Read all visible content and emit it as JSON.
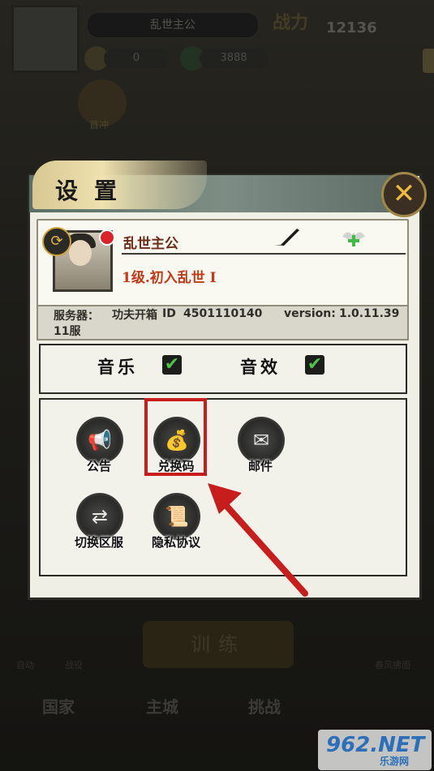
{
  "background": {
    "top_name": "乱世主公",
    "power_label": "战力",
    "power_value": "12136",
    "resource_coin": "0",
    "resource_jade": "3888",
    "gift_label": "首冲",
    "train_label": "训练",
    "bottom_nav": [
      "国家",
      "主城",
      "挑战"
    ],
    "bottom_small": [
      "自动",
      "战役",
      "春风拂面"
    ],
    "watermark": "962.NET",
    "watermark_sub": "乐游网"
  },
  "dialog": {
    "title": "设置",
    "close_icon": "close-x-icon",
    "profile": {
      "name": "乱世主公",
      "level": "1级.初入乱世 I",
      "server_label": "服务器：",
      "server_value": "功夫开箱11服",
      "id_label": "ID",
      "id_value": "4501110140",
      "version_label": "version:",
      "version_value": "1.0.11.39"
    },
    "audio": {
      "music_label": "音乐",
      "music_checked": true,
      "sfx_label": "音效",
      "sfx_checked": true
    },
    "menu": [
      {
        "label": "公告",
        "icon": "megaphone-icon"
      },
      {
        "label": "兑换码",
        "icon": "money-bag-icon"
      },
      {
        "label": "邮件",
        "icon": "envelope-icon"
      },
      {
        "label": "切换区服",
        "icon": "switch-server-icon"
      },
      {
        "label": "隐私协议",
        "icon": "scroll-icon"
      }
    ]
  },
  "colors": {
    "highlight": "#c71d1d",
    "check": "#4ec247",
    "level_text": "#c23a1a"
  }
}
